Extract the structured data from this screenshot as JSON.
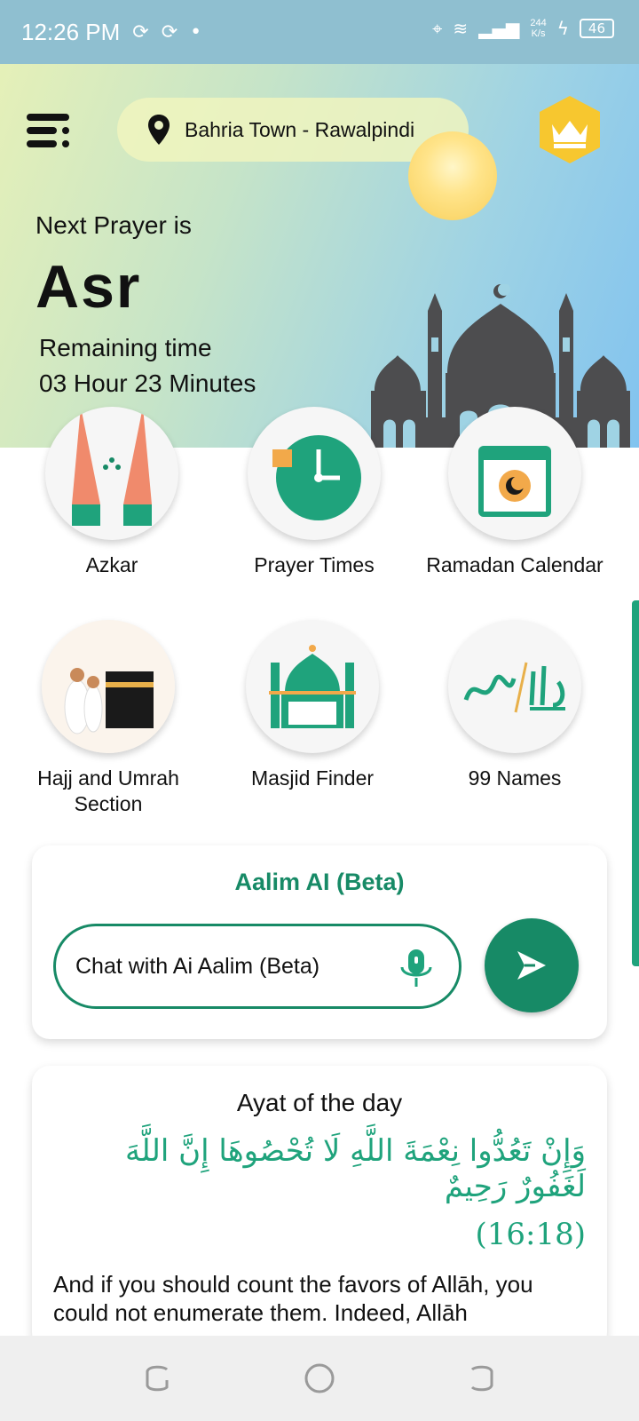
{
  "status_bar": {
    "time": "12:26 PM",
    "net_speed_value": "244",
    "net_speed_unit": "K/s",
    "battery": "46"
  },
  "header": {
    "location": "Bahria Town - Rawalpindi"
  },
  "hero": {
    "next_label": "Next Prayer is",
    "prayer_name": "Asr",
    "remaining_label": "Remaining time",
    "remaining_value": "03 Hour 23 Minutes"
  },
  "features": [
    {
      "label": "Azkar"
    },
    {
      "label": "Prayer Times"
    },
    {
      "label": "Ramadan Calendar"
    },
    {
      "label": "Hajj and Umrah Section"
    },
    {
      "label": "Masjid Finder"
    },
    {
      "label": "99 Names"
    }
  ],
  "ai_card": {
    "title": "Aalim AI (Beta)",
    "placeholder": "Chat with Ai Aalim (Beta)"
  },
  "ayat_card": {
    "title": "Ayat of the day",
    "arabic": "وَإِنْ تَعُدُّوا نِعْمَةَ اللَّهِ لَا تُحْصُوهَا إِنَّ اللَّهَ لَغَفُورٌ رَحِيمٌ",
    "reference": "(16:18)",
    "translation": "And if you should count the favors of Allāh, you could not enumerate them. Indeed, Allāh"
  },
  "colors": {
    "accent": "#178a66",
    "accent_light": "#1fa37c",
    "crown_badge": "#f7c72f"
  }
}
